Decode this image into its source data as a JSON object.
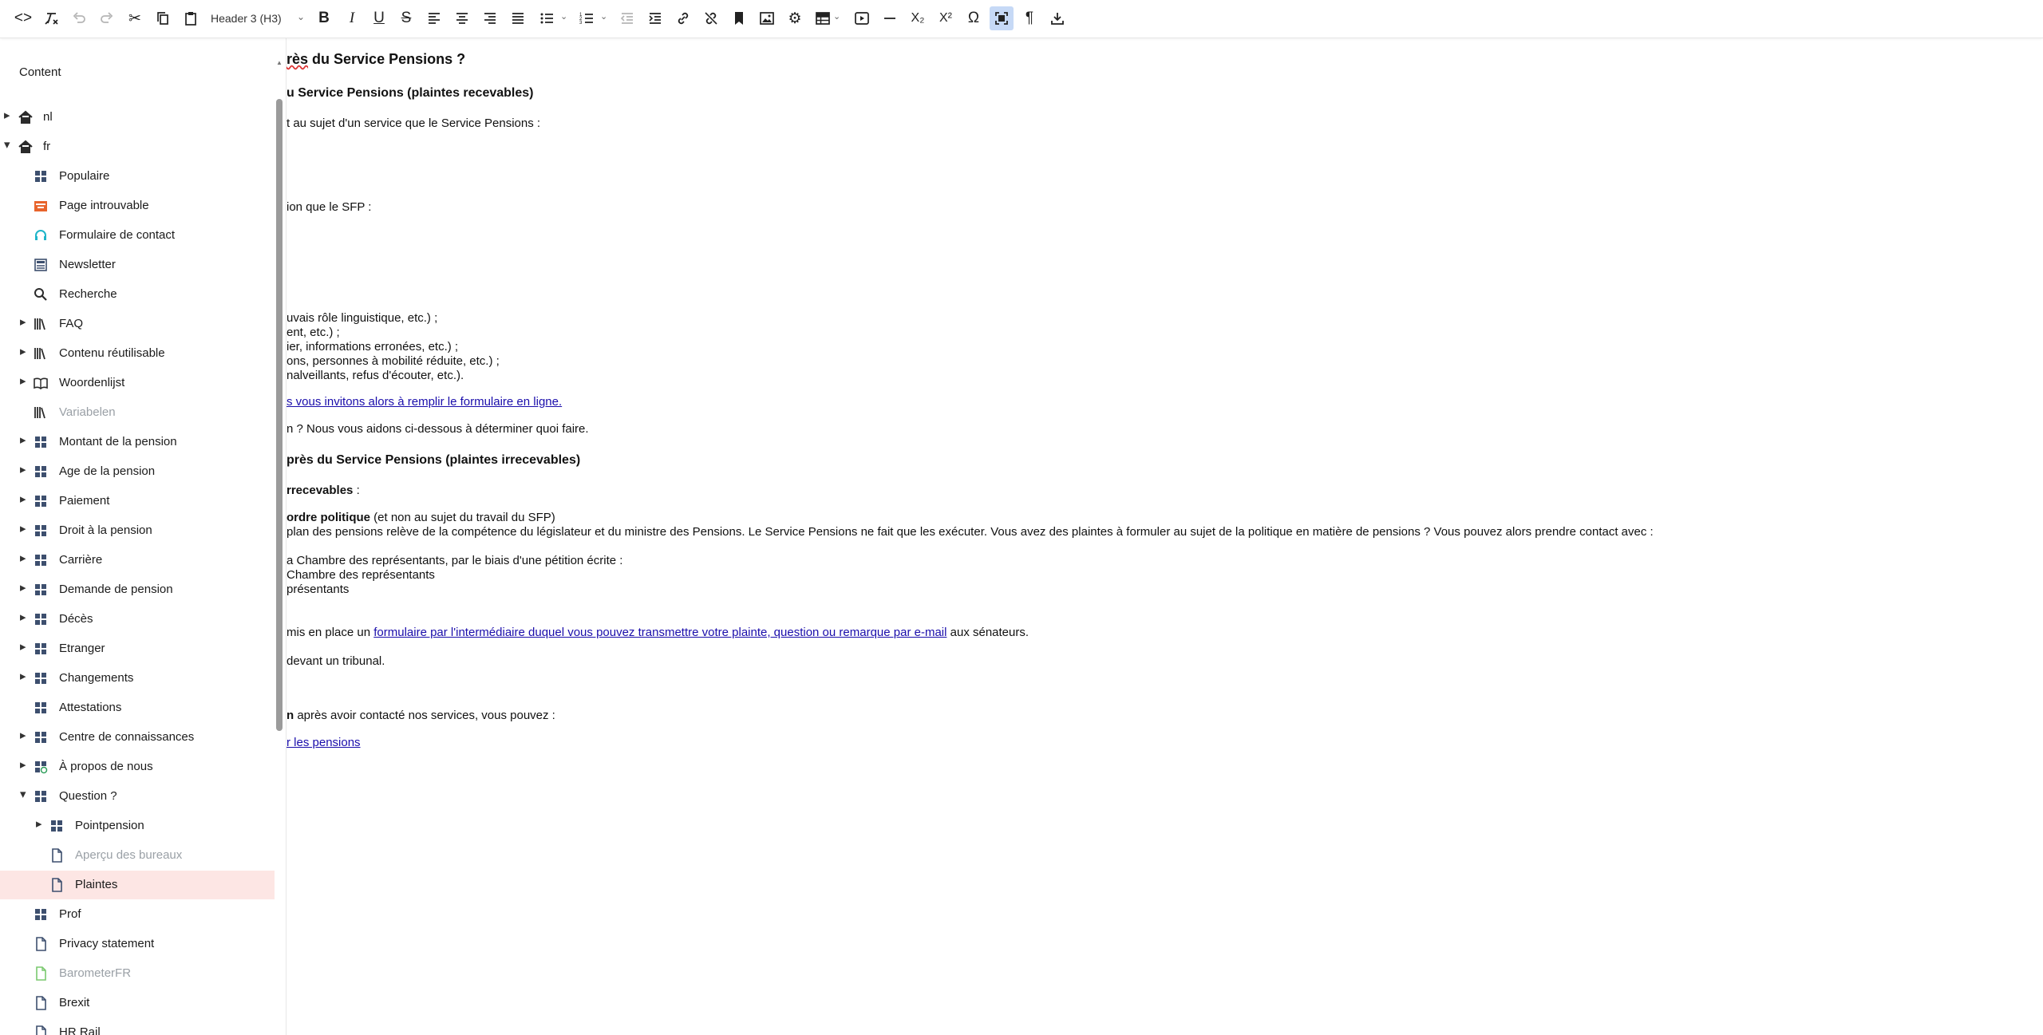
{
  "toolbar": {
    "block_format": "Header 3 (H3)"
  },
  "sidebar": {
    "title": "Content",
    "items": [
      {
        "label": "nl",
        "level": 0,
        "arrow": "right",
        "icon": "home-icon",
        "muted": false
      },
      {
        "label": "fr",
        "level": 0,
        "arrow": "down",
        "icon": "home-icon",
        "muted": false
      },
      {
        "label": "Populaire",
        "level": 1,
        "arrow": "",
        "icon": "grid-icon",
        "muted": false
      },
      {
        "label": "Page introuvable",
        "level": 1,
        "arrow": "",
        "icon": "error-page-icon",
        "muted": false
      },
      {
        "label": "Formulaire de contact",
        "level": 1,
        "arrow": "",
        "icon": "headset-icon",
        "muted": false
      },
      {
        "label": "Newsletter",
        "level": 1,
        "arrow": "",
        "icon": "newspaper-icon",
        "muted": false
      },
      {
        "label": "Recherche",
        "level": 1,
        "arrow": "",
        "icon": "search-icon",
        "muted": false
      },
      {
        "label": "FAQ",
        "level": 1,
        "arrow": "right",
        "icon": "library-icon",
        "muted": false
      },
      {
        "label": "Contenu réutilisable",
        "level": 1,
        "arrow": "right",
        "icon": "library-icon",
        "muted": false
      },
      {
        "label": "Woordenlijst",
        "level": 1,
        "arrow": "right",
        "icon": "book-icon",
        "muted": false
      },
      {
        "label": "Variabelen",
        "level": 1,
        "arrow": "",
        "icon": "library-icon",
        "muted": true
      },
      {
        "label": "Montant de la pension",
        "level": 1,
        "arrow": "right",
        "icon": "grid-icon",
        "muted": false
      },
      {
        "label": "Age de la pension",
        "level": 1,
        "arrow": "right",
        "icon": "grid-icon",
        "muted": false
      },
      {
        "label": "Paiement",
        "level": 1,
        "arrow": "right",
        "icon": "grid-icon",
        "muted": false
      },
      {
        "label": "Droit à la pension",
        "level": 1,
        "arrow": "right",
        "icon": "grid-icon",
        "muted": false
      },
      {
        "label": "Carrière",
        "level": 1,
        "arrow": "right",
        "icon": "grid-icon",
        "muted": false
      },
      {
        "label": "Demande de pension",
        "level": 1,
        "arrow": "right",
        "icon": "grid-icon",
        "muted": false
      },
      {
        "label": "Décès",
        "level": 1,
        "arrow": "right",
        "icon": "grid-icon",
        "muted": false
      },
      {
        "label": "Etranger",
        "level": 1,
        "arrow": "right",
        "icon": "grid-icon",
        "muted": false
      },
      {
        "label": "Changements",
        "level": 1,
        "arrow": "right",
        "icon": "grid-icon",
        "muted": false
      },
      {
        "label": "Attestations",
        "level": 1,
        "arrow": "",
        "icon": "grid-icon",
        "muted": false
      },
      {
        "label": "Centre de connaissances",
        "level": 1,
        "arrow": "right",
        "icon": "grid-icon",
        "muted": false
      },
      {
        "label": "À propos de nous",
        "level": 1,
        "arrow": "right",
        "icon": "grid-globe-icon",
        "muted": false
      },
      {
        "label": "Question ?",
        "level": 1,
        "arrow": "down",
        "icon": "grid-icon",
        "muted": false
      },
      {
        "label": "Pointpension",
        "level": 2,
        "arrow": "right",
        "icon": "grid-icon",
        "muted": false
      },
      {
        "label": "Aperçu des bureaux",
        "level": 2,
        "arrow": "",
        "icon": "document-icon",
        "muted": true
      },
      {
        "label": "Plaintes",
        "level": 2,
        "arrow": "",
        "icon": "document-icon",
        "muted": false,
        "selected": true
      },
      {
        "label": "Prof",
        "level": 1,
        "arrow": "",
        "icon": "grid-icon",
        "muted": false
      },
      {
        "label": "Privacy statement",
        "level": 1,
        "arrow": "",
        "icon": "document-icon",
        "muted": false
      },
      {
        "label": "BarometerFR",
        "level": 1,
        "arrow": "",
        "icon": "document-green-icon",
        "muted": true
      },
      {
        "label": "Brexit",
        "level": 1,
        "arrow": "",
        "icon": "document-icon",
        "muted": false
      },
      {
        "label": "HR Rail",
        "level": 1,
        "arrow": "",
        "icon": "document-icon",
        "muted": false
      }
    ]
  },
  "editor": {
    "l1_pre": "",
    "l1_spell": "rès",
    "l1_post": " du Service Pensions ?",
    "l2": "u Service Pensions (plaintes recevables)",
    "l3": "t au sujet d'un service que le Service Pensions :",
    "l4": "ion que le SFP :",
    "l5": "uvais rôle linguistique, etc.) ;",
    "l6": "ent, etc.) ;",
    "l7": "ier, informations erronées, etc.) ;",
    "l8": "ons, personnes à mobilité réduite, etc.) ;",
    "l9": "nalveillants, refus d'écouter, etc.).",
    "l10_link": "s vous invitons alors à remplir le formulaire en ligne.",
    "l11": "n ? Nous vous aidons ci-dessous à déterminer quoi faire.",
    "l12": "près du Service Pensions (plaintes irrecevables)",
    "l13_bold": "rrecevables",
    "l13_rest": " :",
    "l14_bold": "ordre politique",
    "l14_rest": " (et non au sujet du travail du SFP)",
    "l15": "plan des pensions relève de la compétence du législateur et du ministre des Pensions. Le Service Pensions ne fait que les exécuter. Vous avez des plaintes à formuler au sujet de la politique en matière de pensions ? Vous pouvez alors prendre contact avec :",
    "l16": "a Chambre des représentants, par le biais d'une pétition écrite :",
    "l17": "Chambre des représentants",
    "l18": "présentants",
    "l19_pre": "mis en place un ",
    "l19_link": "formulaire par l'intermédiaire duquel vous pouvez transmettre votre plainte, question ou remarque par e-mail",
    "l19_post": " aux sénateurs.",
    "l20": "devant un tribunal.",
    "l21_bold": "n",
    "l21_rest": " après avoir contacté nos services, vous pouvez :",
    "l22_link": "r les pensions"
  }
}
